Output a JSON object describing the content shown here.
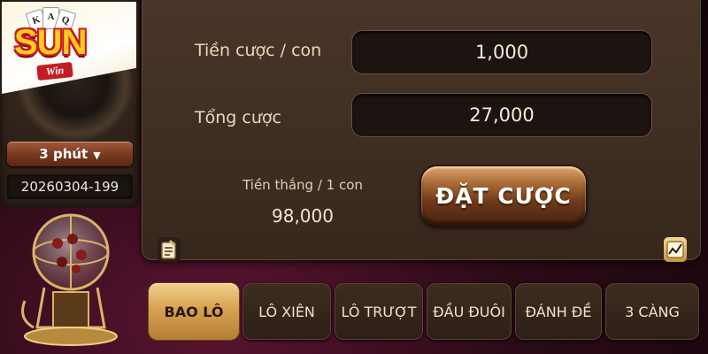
{
  "brand": {
    "logo_text": "SUN",
    "logo_sub": "Win",
    "cards": [
      "K",
      "A",
      "Q"
    ]
  },
  "round": {
    "period": "3 phút",
    "draw_id": "20260304-199"
  },
  "bet": {
    "per_number_label": "Tiền cược / con",
    "per_number_value": "1,000",
    "total_label": "Tổng cược",
    "total_value": "27,000",
    "win_label": "Tiền thắng / 1 con",
    "win_value": "98,000",
    "place_bet_label": "ĐẶT CƯỢC"
  },
  "tabs": [
    {
      "label": "BAO LÔ",
      "active": true
    },
    {
      "label": "LÔ XIÊN",
      "active": false
    },
    {
      "label": "LÔ TRƯỢT",
      "active": false
    },
    {
      "label": "ĐẦU ĐUÔI",
      "active": false
    },
    {
      "label": "ĐÁNH ĐỀ",
      "active": false
    },
    {
      "label": "3 CÀNG",
      "active": false
    }
  ],
  "icons": {
    "history": "note-icon",
    "stats": "chart-icon",
    "period_dropdown": "chevron-down-icon"
  },
  "colors": {
    "accent_gold": "#d6a252",
    "panel_brown": "#3e2d22",
    "logo_red": "#c9181e",
    "logo_yellow": "#ffcc22"
  }
}
